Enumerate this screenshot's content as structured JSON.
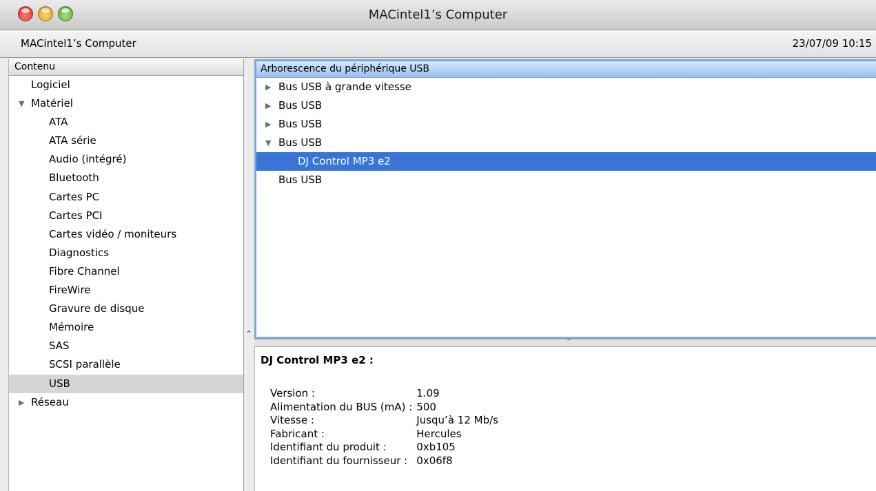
{
  "window": {
    "title": "MACintel1’s Computer"
  },
  "infobar": {
    "computer_name": "MACintel1’s Computer",
    "timestamp": "23/07/09 10:15"
  },
  "sidebar": {
    "header": "Contenu",
    "items": [
      {
        "label": "Logiciel",
        "level": 0,
        "toggle": "none"
      },
      {
        "label": "Matériel",
        "level": 0,
        "toggle": "expanded"
      },
      {
        "label": "ATA",
        "level": 1
      },
      {
        "label": "ATA série",
        "level": 1
      },
      {
        "label": "Audio (intégré)",
        "level": 1
      },
      {
        "label": "Bluetooth",
        "level": 1
      },
      {
        "label": "Cartes PC",
        "level": 1
      },
      {
        "label": "Cartes PCI",
        "level": 1
      },
      {
        "label": "Cartes vidéo / moniteurs",
        "level": 1
      },
      {
        "label": "Diagnostics",
        "level": 1
      },
      {
        "label": "Fibre Channel",
        "level": 1
      },
      {
        "label": "FireWire",
        "level": 1
      },
      {
        "label": "Gravure de disque",
        "level": 1
      },
      {
        "label": "Mémoire",
        "level": 1
      },
      {
        "label": "SAS",
        "level": 1
      },
      {
        "label": "SCSI parallèle",
        "level": 1
      },
      {
        "label": "USB",
        "level": 1,
        "selected": true
      },
      {
        "label": "Réseau",
        "level": 0,
        "toggle": "collapsed"
      }
    ]
  },
  "usb_tree": {
    "header": "Arborescence du périphérique USB",
    "rows": [
      {
        "label": "Bus USB à grande vitesse",
        "toggle": "collapsed"
      },
      {
        "label": "Bus USB",
        "toggle": "collapsed"
      },
      {
        "label": "Bus USB",
        "toggle": "collapsed"
      },
      {
        "label": "Bus USB",
        "toggle": "expanded"
      },
      {
        "label": "DJ Control MP3 e2",
        "child": true,
        "selected": true
      },
      {
        "label": "Bus USB",
        "toggle": "none"
      }
    ]
  },
  "details": {
    "title": "DJ Control MP3 e2 :",
    "properties": [
      {
        "key": "Version :",
        "value": "1.09"
      },
      {
        "key": "Alimentation du BUS (mA) :",
        "value": "500"
      },
      {
        "key": "Vitesse :",
        "value": "Jusqu’à 12 Mb/s"
      },
      {
        "key": "Fabricant :",
        "value": "Hercules"
      },
      {
        "key": "Identifiant du produit :",
        "value": "0xb105"
      },
      {
        "key": "Identifiant du fournisseur :",
        "value": "0x06f8"
      }
    ]
  },
  "icons": {
    "expanded": "▼",
    "collapsed": "▶"
  },
  "colors": {
    "selection": "#3875d7",
    "tree_border": "#7ea6dc",
    "sidebar_selection": "#d5d5d5"
  }
}
